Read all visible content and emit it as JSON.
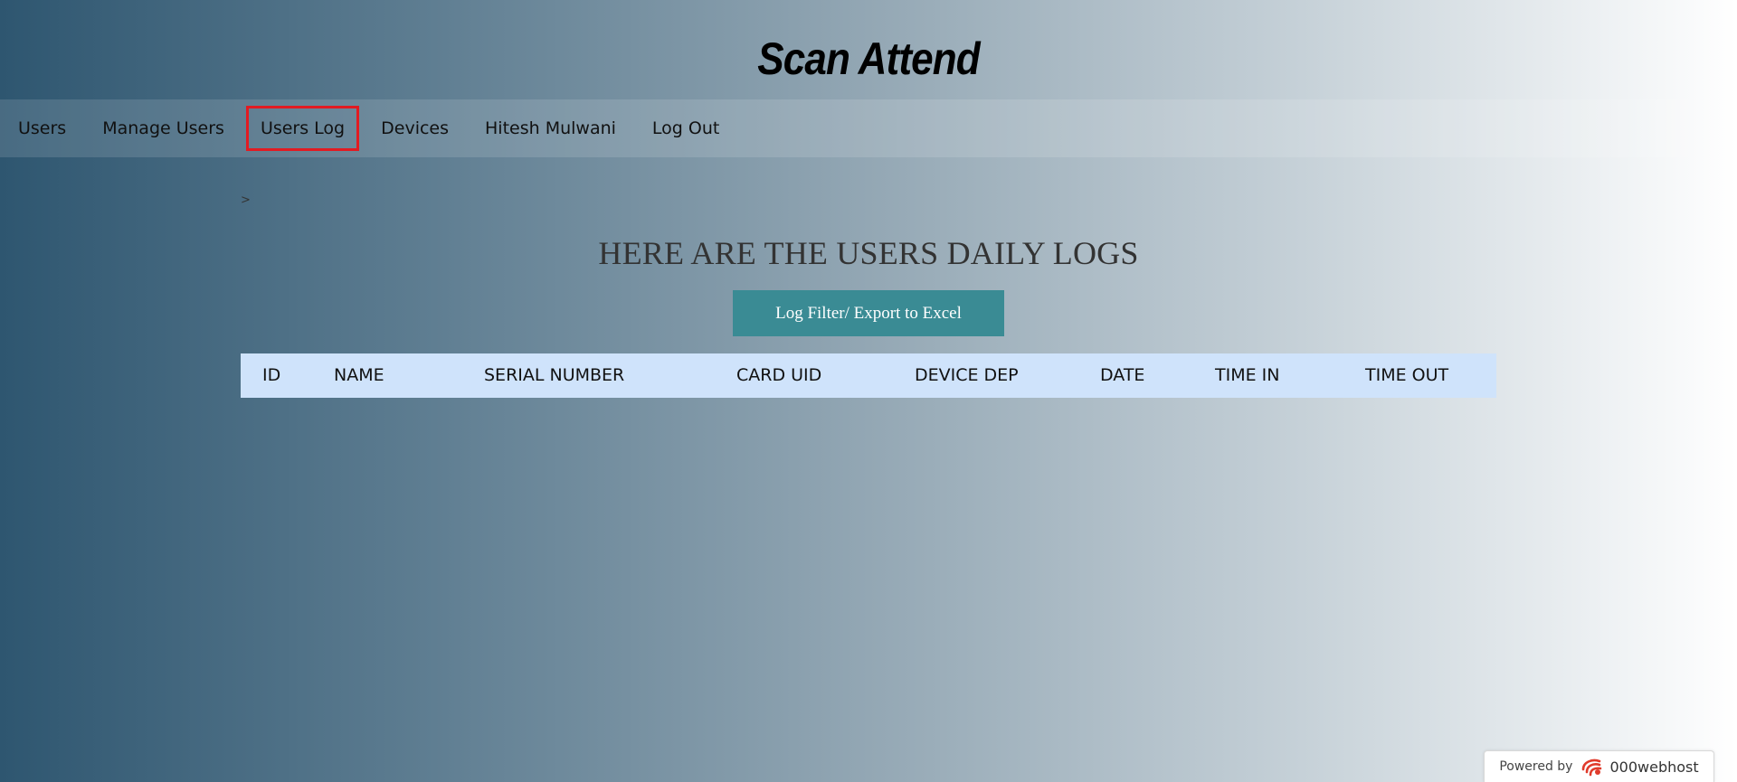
{
  "app": {
    "title": "Scan Attend"
  },
  "nav": {
    "items": [
      {
        "label": "Users",
        "active": false
      },
      {
        "label": "Manage Users",
        "active": false
      },
      {
        "label": "Users Log",
        "active": true
      },
      {
        "label": "Devices",
        "active": false
      },
      {
        "label": "Hitesh Mulwani",
        "active": false
      },
      {
        "label": "Log Out",
        "active": false
      }
    ]
  },
  "breadcrumb": {
    "text": ">"
  },
  "main": {
    "heading": "HERE ARE THE USERS DAILY LOGS",
    "filter_button_label": "Log Filter/ Export to Excel",
    "table": {
      "columns": [
        "ID",
        "NAME",
        "SERIAL NUMBER",
        "CARD UID",
        "DEVICE DEP",
        "DATE",
        "TIME IN",
        "TIME OUT"
      ],
      "rows": []
    }
  },
  "footer": {
    "powered_by": "Powered by",
    "host_name": "000webhost"
  },
  "colors": {
    "active_outline": "#e21b22",
    "button_bg": "#3a8b94",
    "table_header_bg": "#cfe3fb"
  }
}
